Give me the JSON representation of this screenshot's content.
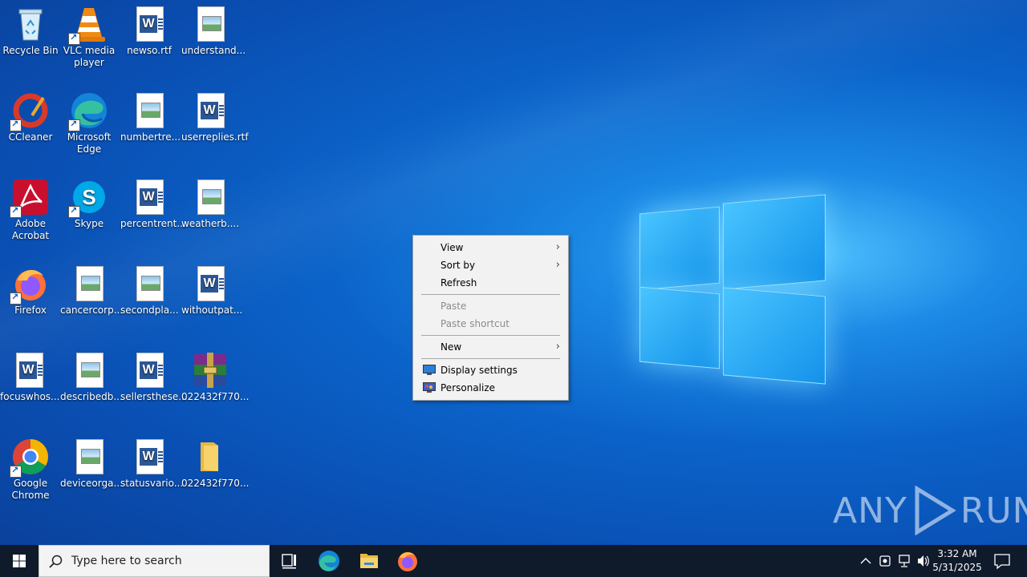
{
  "desktop": {
    "icons": [
      {
        "label": "Recycle Bin"
      },
      {
        "label": "VLC media player"
      },
      {
        "label": "newso.rtf"
      },
      {
        "label": "understand..."
      },
      {
        "label": "CCleaner"
      },
      {
        "label": "Microsoft Edge"
      },
      {
        "label": "numbertre..."
      },
      {
        "label": "userreplies.rtf"
      },
      {
        "label": "Adobe Acrobat"
      },
      {
        "label": "Skype"
      },
      {
        "label": "percentrent..."
      },
      {
        "label": "weatherb...."
      },
      {
        "label": "Firefox"
      },
      {
        "label": "cancercorp..."
      },
      {
        "label": "secondpla..."
      },
      {
        "label": "withoutpat..."
      },
      {
        "label": "focuswhos..."
      },
      {
        "label": "describedb..."
      },
      {
        "label": "sellersthese..."
      },
      {
        "label": "022432f770..."
      },
      {
        "label": "Google Chrome"
      },
      {
        "label": "deviceorga..."
      },
      {
        "label": "statusvario..."
      },
      {
        "label": "022432f770..."
      }
    ]
  },
  "context_menu": {
    "items": [
      {
        "label": "View"
      },
      {
        "label": "Sort by"
      },
      {
        "label": "Refresh"
      },
      {
        "label": "Paste"
      },
      {
        "label": "Paste shortcut"
      },
      {
        "label": "New"
      },
      {
        "label": "Display settings"
      },
      {
        "label": "Personalize"
      }
    ]
  },
  "taskbar": {
    "search_placeholder": "Type here to search",
    "clock_time": "3:32 AM",
    "clock_date": "5/31/2025"
  },
  "watermark": {
    "text": "ANY RUN"
  },
  "colors": {
    "accent": "#0a63c9",
    "taskbar": "#0f1a2b",
    "menu_bg": "#f2f2f2"
  }
}
